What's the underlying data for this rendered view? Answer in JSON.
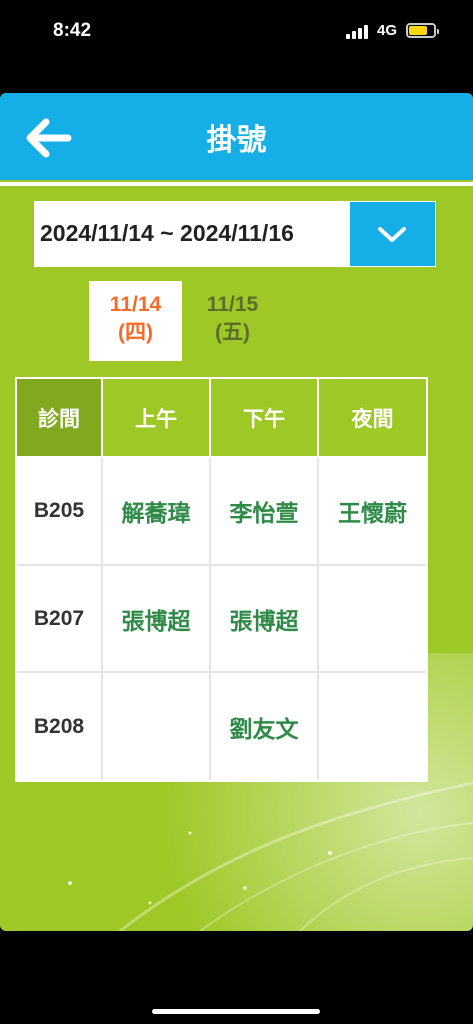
{
  "status_bar": {
    "time": "8:42",
    "network": "4G"
  },
  "header": {
    "title": "掛號",
    "back_icon": "arrow-left-icon",
    "color": "#16aee6"
  },
  "date_range": {
    "value": "2024/11/14 ~ 2024/11/16",
    "dropdown_icon": "chevron-down-icon"
  },
  "day_tabs": [
    {
      "date": "11/14",
      "weekday": "(四)",
      "selected": true
    },
    {
      "date": "11/15",
      "weekday": "(五)",
      "selected": false
    }
  ],
  "schedule": {
    "headers": [
      "診間",
      "上午",
      "下午",
      "夜間"
    ],
    "rows": [
      {
        "room": "B205",
        "morning": "解蕎瑋",
        "afternoon": "李怡萱",
        "night": "王懷蔚"
      },
      {
        "room": "B207",
        "morning": "張博超",
        "afternoon": "張博超",
        "night": ""
      },
      {
        "room": "B208",
        "morning": "",
        "afternoon": "劉友文",
        "night": ""
      }
    ]
  },
  "colors": {
    "background_green": "#9dc825",
    "selected_date": "#f26b2a",
    "doctor_text": "#2f8a48"
  }
}
